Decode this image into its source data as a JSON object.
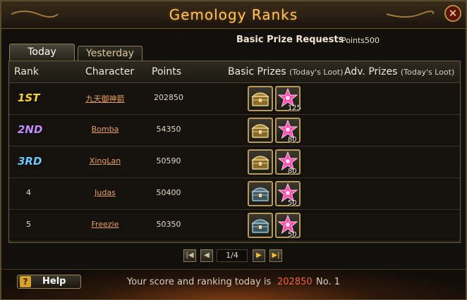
{
  "window": {
    "title": "Gemology Ranks",
    "close_glyph": "✕"
  },
  "request": {
    "label": "Basic Prize Requests",
    "points": "Points500"
  },
  "tabs": {
    "today": "Today",
    "yesterday": "Yesterday"
  },
  "headers": {
    "rank": "Rank",
    "character": "Character",
    "points": "Points",
    "basic": "Basic Prizes",
    "basic_sub": "(Today's Loot)",
    "adv": "Adv. Prizes",
    "adv_sub": "(Today's Loot)"
  },
  "rows": [
    {
      "rank": "1ST",
      "character": "九天御神箭",
      "points": "202850",
      "gem_count": "125",
      "chest": "gold-chest-icon"
    },
    {
      "rank": "2ND",
      "character": "Bomba",
      "points": "54350",
      "gem_count": "80",
      "chest": "gold-chest-icon"
    },
    {
      "rank": "3RD",
      "character": "XingLan",
      "points": "50590",
      "gem_count": "80",
      "chest": "gold-chest-icon"
    },
    {
      "rank": "4",
      "character": "Judas",
      "points": "50400",
      "gem_count": "50",
      "chest": "silver-chest-icon"
    },
    {
      "rank": "5",
      "character": "Freezie",
      "points": "50350",
      "gem_count": "50",
      "chest": "silver-chest-icon"
    }
  ],
  "rank_colors": {
    "1ST": "#ffd23a",
    "2ND": "#c48cff",
    "3RD": "#6cc8ff"
  },
  "pager": {
    "page": "1/4"
  },
  "footer": {
    "help": "Help",
    "help_glyph": "?",
    "score_text": "Your score and ranking today is",
    "score_value": "202850",
    "rank_text": "No. 1"
  }
}
